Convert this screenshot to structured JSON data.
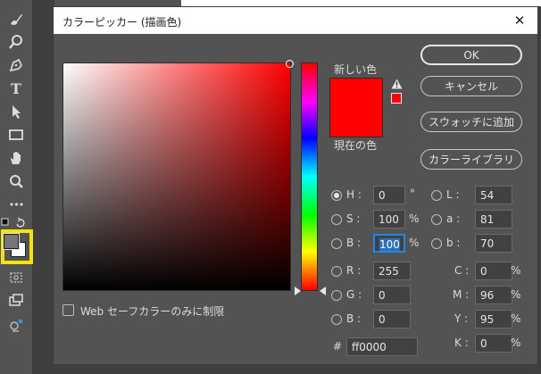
{
  "dialog": {
    "title": "カラーピッカー (描画色)",
    "close_glyph": "✕",
    "new_label": "新しい色",
    "current_label": "現在の色",
    "new_color": "#ff0000",
    "current_color": "#ff0000",
    "buttons": {
      "ok": "OK",
      "cancel": "キャンセル",
      "swatches": "スウォッチに追加",
      "libraries": "カラーライブラリ"
    },
    "hsb": {
      "h_label": "H :",
      "h_value": "0",
      "h_unit": "°",
      "s_label": "S :",
      "s_value": "100",
      "s_unit": "%",
      "b_label": "B :",
      "b_value": "100",
      "b_unit": "%"
    },
    "lab": {
      "l_label": "L :",
      "l_value": "54",
      "a_label": "a :",
      "a_value": "81",
      "b_label": "b :",
      "b_value": "70"
    },
    "rgb": {
      "r_label": "R :",
      "r_value": "255",
      "g_label": "G :",
      "g_value": "0",
      "b_label": "B :",
      "b_value": "0"
    },
    "cmyk": {
      "c_label": "C :",
      "c_value": "0",
      "c_unit": "%",
      "m_label": "M :",
      "m_value": "96",
      "m_unit": "%",
      "y_label": "Y :",
      "y_value": "95",
      "y_unit": "%",
      "k_label": "K :",
      "k_value": "0",
      "k_unit": "%"
    },
    "hex_label": "#",
    "hex_value": "ff0000",
    "web_safe_label": "Web セーフカラーのみに制限",
    "selected_mode": "H"
  },
  "toolbar": {
    "tools": [
      "brush-icon",
      "magnifier-icon",
      "pen-icon",
      "type-icon",
      "selection-arrow-icon",
      "rectangle-icon",
      "hand-icon",
      "zoom-icon",
      "more-icon"
    ],
    "type_glyph": "T",
    "more_glyph": "•••",
    "foreground_color": "#767676",
    "background_color": "#ffffff",
    "highlight_color": "#f5e30a"
  }
}
